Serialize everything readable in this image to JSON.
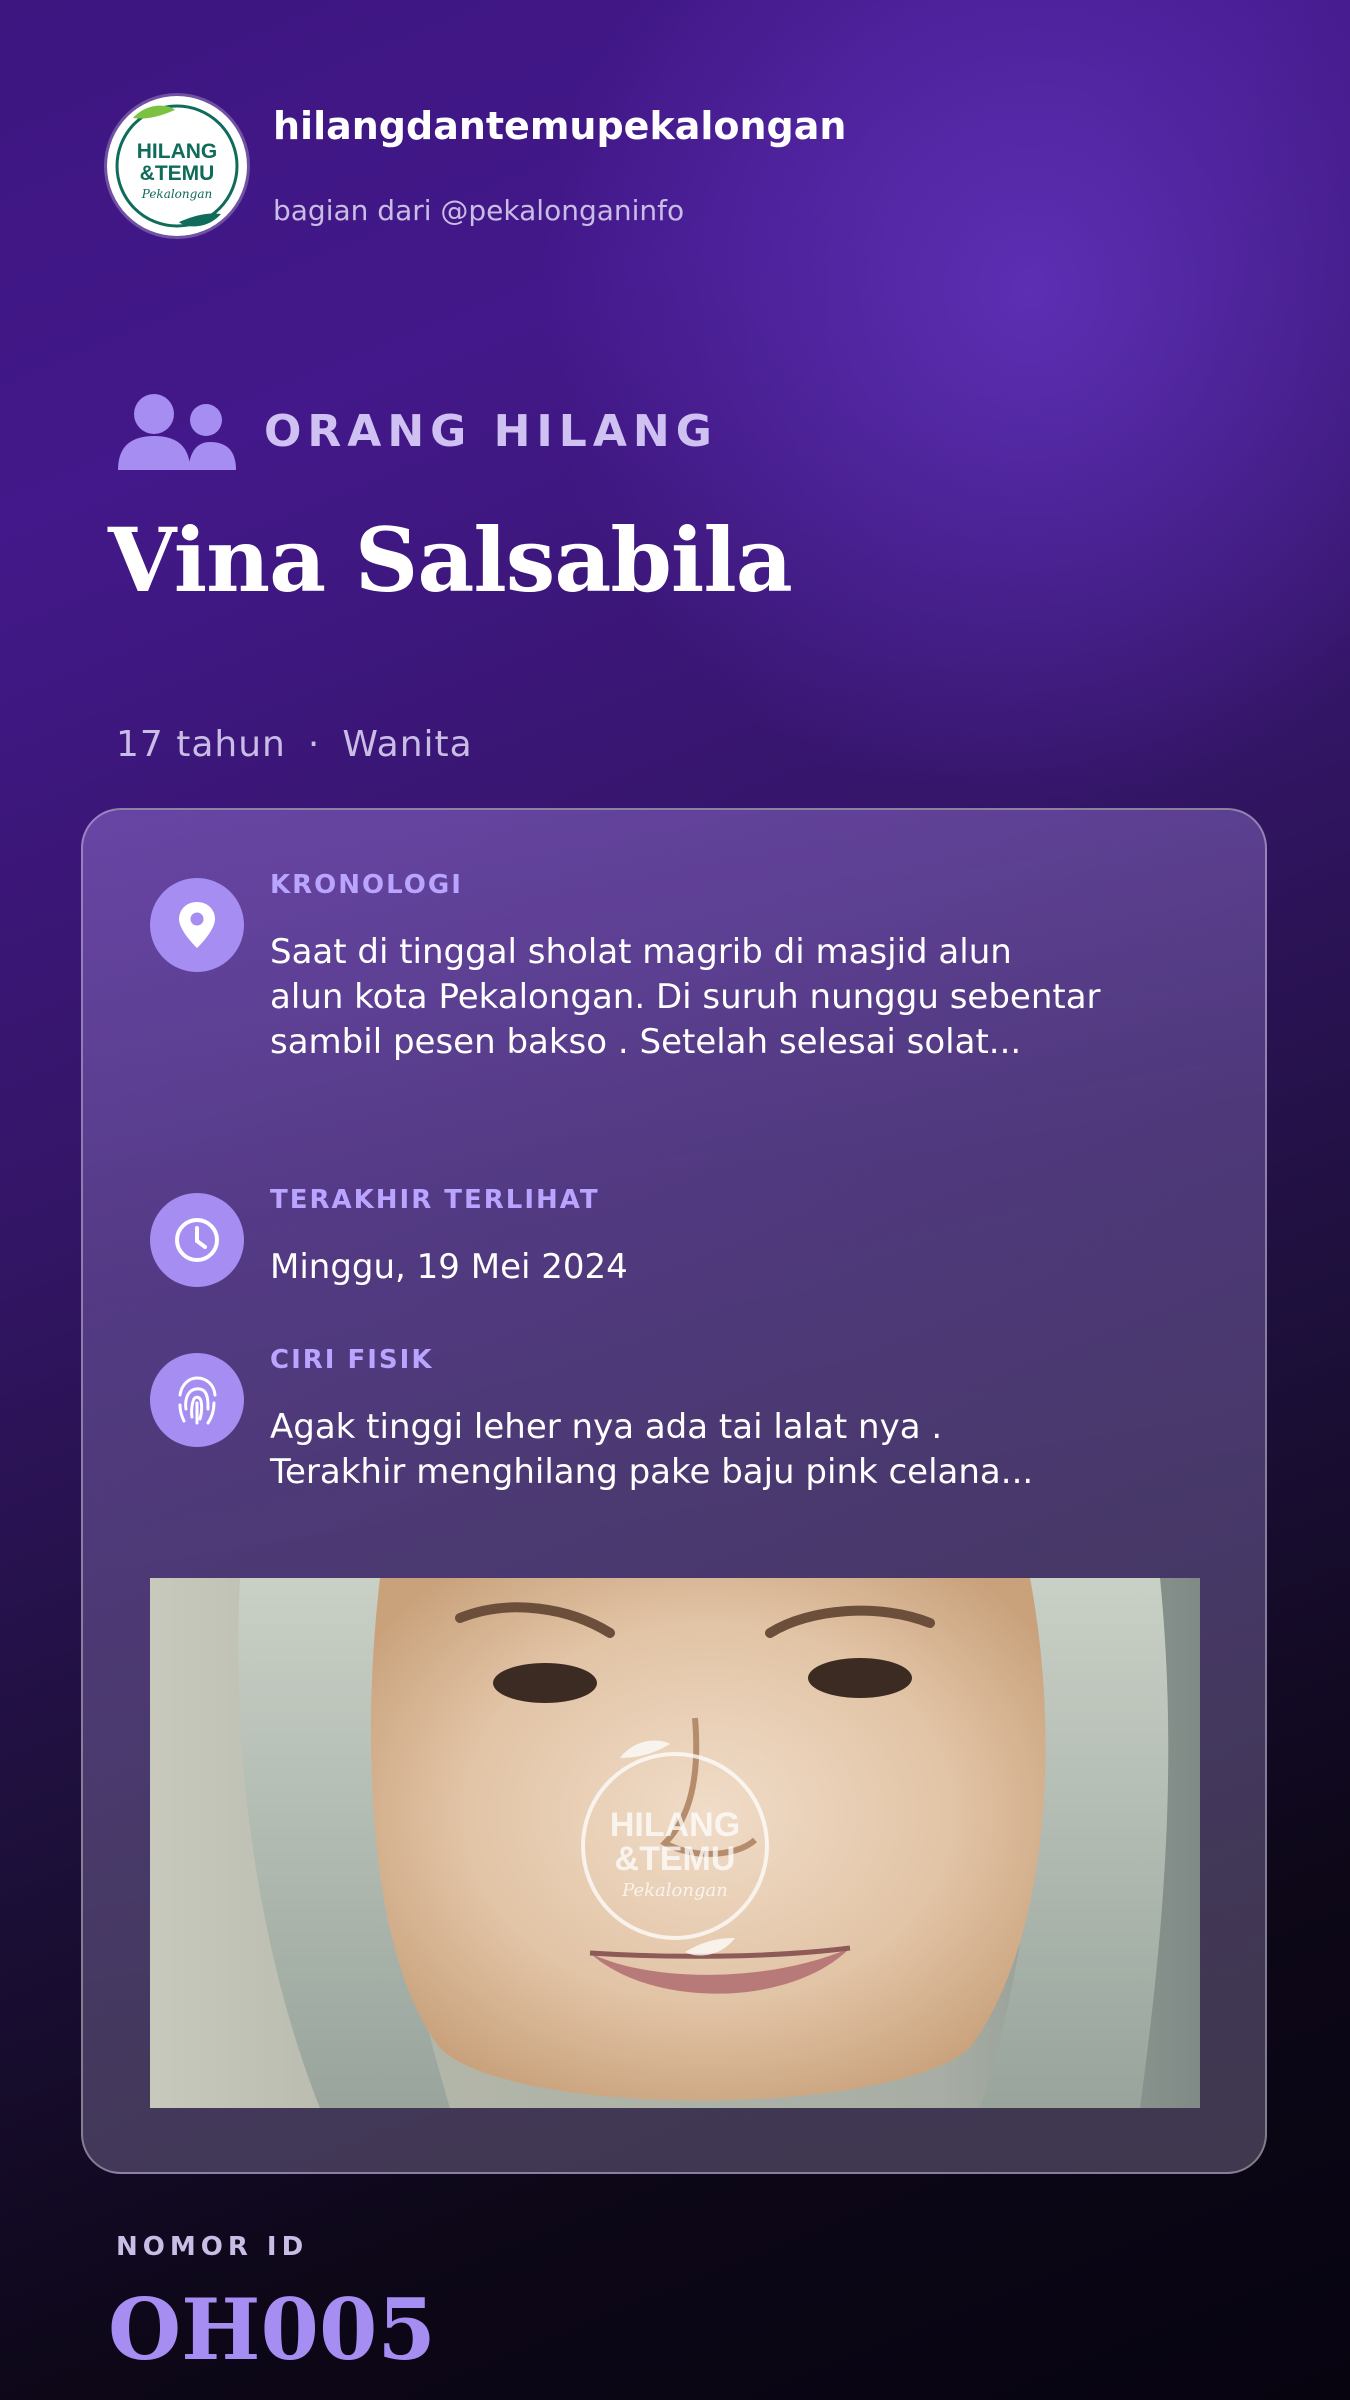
{
  "account": {
    "handle": "hilangdantemupekalongan",
    "subtitle": "bagian dari @pekalonganinfo",
    "logo_text_top": "HILANG",
    "logo_text_mid": "&TEMU",
    "logo_text_script": "Pekalongan"
  },
  "category": {
    "icon": "users-icon",
    "label": "ORANG HILANG"
  },
  "person": {
    "name": "Vina Salsabila",
    "age": "17 tahun",
    "separator": "·",
    "gender": "Wanita"
  },
  "details": [
    {
      "icon": "map-pin-icon",
      "title": "KRONOLOGI",
      "lines": [
        "Saat di tinggal sholat magrib di masjid alun",
        "alun kota Pekalongan. Di suruh nunggu sebentar",
        "sambil pesen bakso . Setelah selesai solat..."
      ]
    },
    {
      "icon": "clock-icon",
      "title": "TERAKHIR TERLIHAT",
      "lines": [
        "Minggu, 19 Mei 2024"
      ]
    },
    {
      "icon": "fingerprint-icon",
      "title": "CIRI FISIK",
      "lines": [
        "Agak tinggi leher nya ada tai lalat nya .",
        "Terakhir menghilang pake baju pink celana..."
      ]
    }
  ],
  "photo": {
    "watermark_top": "HILANG",
    "watermark_mid": "&TEMU",
    "watermark_script": "Pekalongan"
  },
  "id": {
    "label": "NOMOR ID",
    "value": "OH005"
  },
  "colors": {
    "accent": "#a58df2",
    "accent_title": "#b9a4ff",
    "muted_text": "#c9bde6",
    "logo_green": "#0f6b5a"
  }
}
